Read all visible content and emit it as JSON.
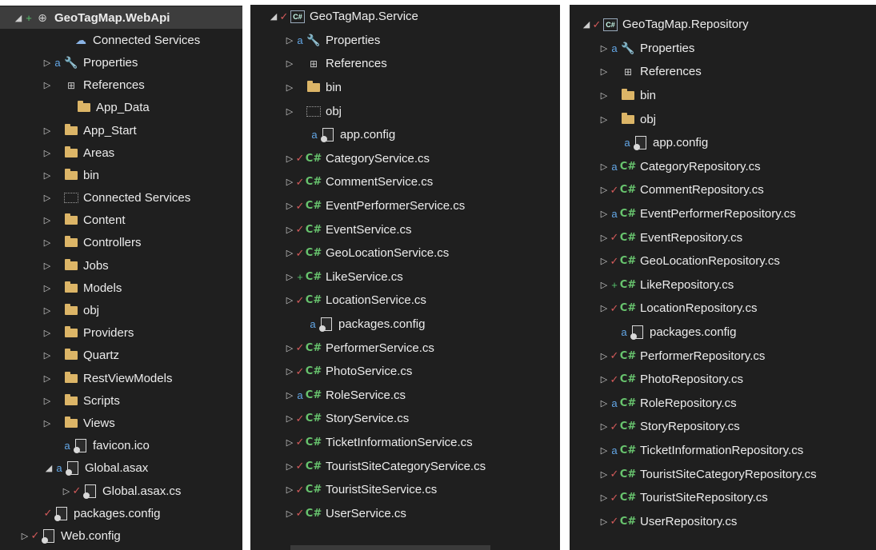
{
  "webapi": {
    "items": [
      {
        "label": "GeoTagMap.WebApi",
        "arrow": "◢",
        "status": "+",
        "icon": "project-icon"
      },
      {
        "label": "Connected Services",
        "arrow": "",
        "status": "",
        "icon": "cloud-icon"
      },
      {
        "label": "Properties",
        "arrow": "▷",
        "status": "lock",
        "icon": "wrench-icon"
      },
      {
        "label": "References",
        "arrow": "▷",
        "status": "",
        "icon": "references-icon"
      },
      {
        "label": "App_Data",
        "arrow": "",
        "status": "",
        "icon": "folder-icon"
      },
      {
        "label": "App_Start",
        "arrow": "▷",
        "status": "",
        "icon": "folder-icon"
      },
      {
        "label": "Areas",
        "arrow": "▷",
        "status": "",
        "icon": "folder-icon"
      },
      {
        "label": "bin",
        "arrow": "▷",
        "status": "",
        "icon": "folder-icon"
      },
      {
        "label": "Connected Services",
        "arrow": "▷",
        "status": "",
        "icon": "folder-dotted-icon"
      },
      {
        "label": "Content",
        "arrow": "▷",
        "status": "",
        "icon": "folder-icon"
      },
      {
        "label": "Controllers",
        "arrow": "▷",
        "status": "",
        "icon": "folder-icon"
      },
      {
        "label": "Jobs",
        "arrow": "▷",
        "status": "",
        "icon": "folder-icon"
      },
      {
        "label": "Models",
        "arrow": "▷",
        "status": "",
        "icon": "folder-icon"
      },
      {
        "label": "obj",
        "arrow": "▷",
        "status": "",
        "icon": "folder-icon"
      },
      {
        "label": "Providers",
        "arrow": "▷",
        "status": "",
        "icon": "folder-icon"
      },
      {
        "label": "Quartz",
        "arrow": "▷",
        "status": "",
        "icon": "folder-icon"
      },
      {
        "label": "RestViewModels",
        "arrow": "▷",
        "status": "",
        "icon": "folder-icon"
      },
      {
        "label": "Scripts",
        "arrow": "▷",
        "status": "",
        "icon": "folder-icon"
      },
      {
        "label": "Views",
        "arrow": "▷",
        "status": "",
        "icon": "folder-icon"
      },
      {
        "label": "favicon.ico",
        "arrow": "",
        "status": "lock",
        "icon": "image-file-icon"
      },
      {
        "label": "Global.asax",
        "arrow": "◢",
        "status": "lock",
        "icon": "asax-file-icon"
      },
      {
        "label": "Global.asax.cs",
        "arrow": "▷",
        "status": "check",
        "icon": "cs-file-icon"
      },
      {
        "label": "packages.config",
        "arrow": "",
        "status": "check",
        "icon": "config-file-icon"
      },
      {
        "label": "Web.config",
        "arrow": "▷",
        "status": "check",
        "icon": "config-file-icon"
      }
    ]
  },
  "service": {
    "items": [
      {
        "label": "GeoTagMap.Service",
        "arrow": "◢",
        "status": "check",
        "icon": "csproj-icon"
      },
      {
        "label": "Properties",
        "arrow": "▷",
        "status": "lock",
        "icon": "wrench-icon"
      },
      {
        "label": "References",
        "arrow": "▷",
        "status": "",
        "icon": "references-icon"
      },
      {
        "label": "bin",
        "arrow": "▷",
        "status": "",
        "icon": "folder-icon"
      },
      {
        "label": "obj",
        "arrow": "▷",
        "status": "",
        "icon": "folder-dotted-icon"
      },
      {
        "label": "app.config",
        "arrow": "",
        "status": "lock",
        "icon": "config-file-icon"
      },
      {
        "label": "CategoryService.cs",
        "arrow": "▷",
        "status": "check",
        "icon": "cs-icon"
      },
      {
        "label": "CommentService.cs",
        "arrow": "▷",
        "status": "check",
        "icon": "cs-icon"
      },
      {
        "label": "EventPerformerService.cs",
        "arrow": "▷",
        "status": "check",
        "icon": "cs-icon"
      },
      {
        "label": "EventService.cs",
        "arrow": "▷",
        "status": "check",
        "icon": "cs-icon"
      },
      {
        "label": "GeoLocationService.cs",
        "arrow": "▷",
        "status": "check",
        "icon": "cs-icon"
      },
      {
        "label": "LikeService.cs",
        "arrow": "▷",
        "status": "+",
        "icon": "cs-icon"
      },
      {
        "label": "LocationService.cs",
        "arrow": "▷",
        "status": "check",
        "icon": "cs-icon"
      },
      {
        "label": "packages.config",
        "arrow": "",
        "status": "lock",
        "icon": "config-file-icon"
      },
      {
        "label": "PerformerService.cs",
        "arrow": "▷",
        "status": "check",
        "icon": "cs-icon"
      },
      {
        "label": "PhotoService.cs",
        "arrow": "▷",
        "status": "check",
        "icon": "cs-icon"
      },
      {
        "label": "RoleService.cs",
        "arrow": "▷",
        "status": "lock",
        "icon": "cs-icon"
      },
      {
        "label": "StoryService.cs",
        "arrow": "▷",
        "status": "check",
        "icon": "cs-icon"
      },
      {
        "label": "TicketInformationService.cs",
        "arrow": "▷",
        "status": "check",
        "icon": "cs-icon"
      },
      {
        "label": "TouristSiteCategoryService.cs",
        "arrow": "▷",
        "status": "check",
        "icon": "cs-icon"
      },
      {
        "label": "TouristSiteService.cs",
        "arrow": "▷",
        "status": "check",
        "icon": "cs-icon"
      },
      {
        "label": "UserService.cs",
        "arrow": "▷",
        "status": "check",
        "icon": "cs-icon"
      }
    ]
  },
  "repository": {
    "items": [
      {
        "label": "GeoTagMap.Repository",
        "arrow": "◢",
        "status": "check",
        "icon": "csproj-icon"
      },
      {
        "label": "Properties",
        "arrow": "▷",
        "status": "lock",
        "icon": "wrench-icon"
      },
      {
        "label": "References",
        "arrow": "▷",
        "status": "",
        "icon": "references-icon"
      },
      {
        "label": "bin",
        "arrow": "▷",
        "status": "",
        "icon": "folder-icon"
      },
      {
        "label": "obj",
        "arrow": "▷",
        "status": "",
        "icon": "folder-icon"
      },
      {
        "label": "app.config",
        "arrow": "",
        "status": "lock",
        "icon": "config-file-icon"
      },
      {
        "label": "CategoryRepository.cs",
        "arrow": "▷",
        "status": "lock",
        "icon": "cs-icon"
      },
      {
        "label": "CommentRepository.cs",
        "arrow": "▷",
        "status": "check",
        "icon": "cs-icon"
      },
      {
        "label": "EventPerformerRepository.cs",
        "arrow": "▷",
        "status": "lock",
        "icon": "cs-icon"
      },
      {
        "label": "EventRepository.cs",
        "arrow": "▷",
        "status": "check",
        "icon": "cs-icon"
      },
      {
        "label": "GeoLocationRepository.cs",
        "arrow": "▷",
        "status": "check",
        "icon": "cs-icon"
      },
      {
        "label": "LikeRepository.cs",
        "arrow": "▷",
        "status": "+",
        "icon": "cs-icon"
      },
      {
        "label": "LocationRepository.cs",
        "arrow": "▷",
        "status": "check",
        "icon": "cs-icon"
      },
      {
        "label": "packages.config",
        "arrow": "",
        "status": "lock",
        "icon": "config-file-icon"
      },
      {
        "label": "PerformerRepository.cs",
        "arrow": "▷",
        "status": "check",
        "icon": "cs-icon"
      },
      {
        "label": "PhotoRepository.cs",
        "arrow": "▷",
        "status": "check",
        "icon": "cs-icon"
      },
      {
        "label": "RoleRepository.cs",
        "arrow": "▷",
        "status": "lock",
        "icon": "cs-icon"
      },
      {
        "label": "StoryRepository.cs",
        "arrow": "▷",
        "status": "check",
        "icon": "cs-icon"
      },
      {
        "label": "TicketInformationRepository.cs",
        "arrow": "▷",
        "status": "lock",
        "icon": "cs-icon"
      },
      {
        "label": "TouristSiteCategoryRepository.cs",
        "arrow": "▷",
        "status": "check",
        "icon": "cs-icon"
      },
      {
        "label": "TouristSiteRepository.cs",
        "arrow": "▷",
        "status": "check",
        "icon": "cs-icon"
      },
      {
        "label": "UserRepository.cs",
        "arrow": "▷",
        "status": "check",
        "icon": "cs-icon"
      }
    ]
  },
  "colors": {
    "background": "#1f1f1f",
    "folder": "#dcb567",
    "csharp": "#68c46e",
    "checkmark": "#d35a5a",
    "lock": "#64a8e8",
    "plus": "#55c26b"
  }
}
